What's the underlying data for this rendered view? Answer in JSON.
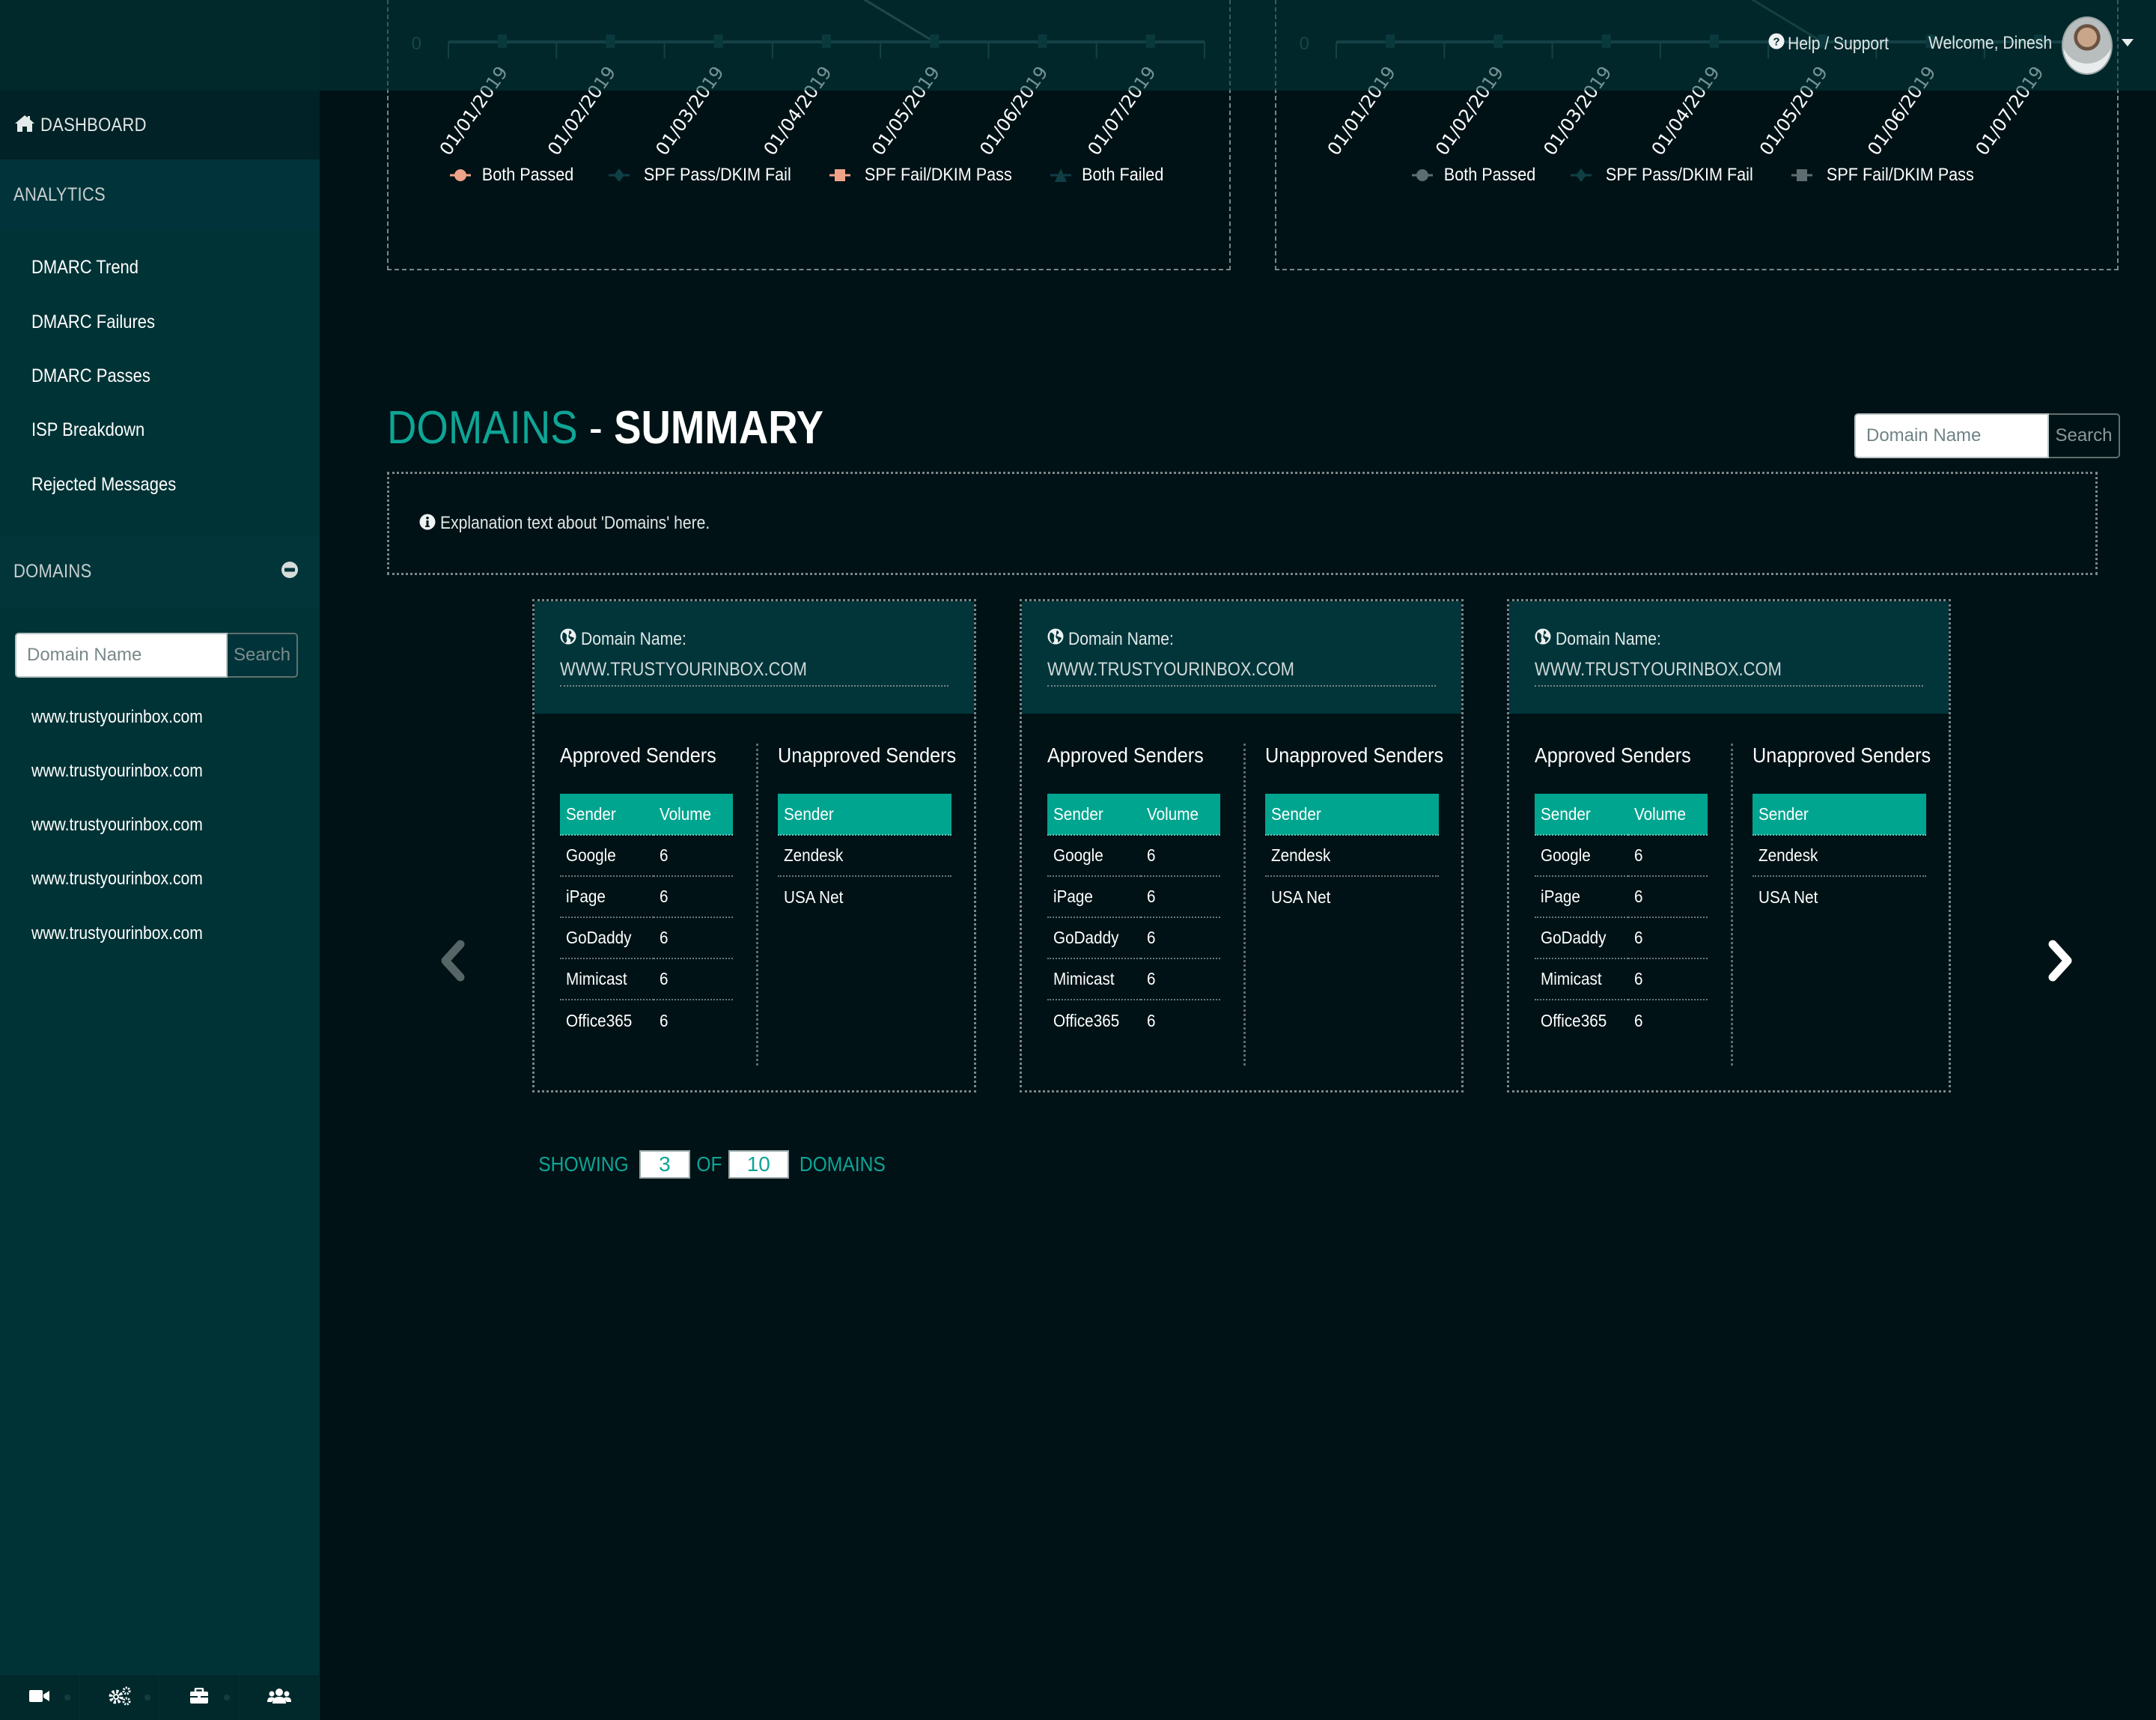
{
  "header": {
    "help_label": "Help / Support",
    "welcome_text": "Welcome, Dinesh",
    "avatar_icon": "user-avatar",
    "menu_icon": "caret-down-icon"
  },
  "sidebar": {
    "dashboard_label": "DASHBOARD",
    "dashboard_icon": "home-icon",
    "analytics_label": "ANALYTICS",
    "analytics_items": [
      {
        "label": "DMARC Trend"
      },
      {
        "label": "DMARC Failures"
      },
      {
        "label": "DMARC Passes"
      },
      {
        "label": "ISP Breakdown"
      },
      {
        "label": "Rejected Messages"
      }
    ],
    "domains_label": "DOMAINS",
    "domains_toggle_icon": "minus-circle-icon",
    "search": {
      "placeholder": "Domain Name",
      "button_label": "Search"
    },
    "domain_links": [
      {
        "label": "www.trustyourinbox.com"
      },
      {
        "label": "www.trustyourinbox.com"
      },
      {
        "label": "www.trustyourinbox.com"
      },
      {
        "label": "www.trustyourinbox.com"
      },
      {
        "label": "www.trustyourinbox.com"
      }
    ],
    "bottom_tools": [
      {
        "icon": "video-camera-icon"
      },
      {
        "icon": "cogs-icon"
      },
      {
        "icon": "briefcase-icon"
      },
      {
        "icon": "users-icon"
      }
    ]
  },
  "chart_data": [
    {
      "type": "line",
      "title": "",
      "x": [
        "01/01/2019",
        "01/02/2019",
        "01/03/2019",
        "01/04/2019",
        "01/05/2019",
        "01/06/2019",
        "01/07/2019"
      ],
      "y_tick_visible": [
        "0"
      ],
      "legend_position": "bottom",
      "series": [
        {
          "name": "Both Passed",
          "color": "#f0a389",
          "marker": "circle"
        },
        {
          "name": "SPF Pass/DKIM Fail",
          "color": "#0f3f45",
          "marker": "diamond"
        },
        {
          "name": "SPF Fail/DKIM Pass",
          "color": "#f0a389",
          "marker": "square"
        },
        {
          "name": "Both Failed",
          "color": "#0f3f45",
          "marker": "triangle"
        }
      ],
      "note": "plot area scrolled out of view; only baseline at 0 and a descending segment ending at 01/05/2019 visible"
    },
    {
      "type": "line",
      "title": "",
      "x": [
        "01/01/2019",
        "01/02/2019",
        "01/03/2019",
        "01/04/2019",
        "01/05/2019",
        "01/06/2019",
        "01/07/2019"
      ],
      "y_tick_visible": [
        "0"
      ],
      "legend_position": "bottom",
      "series": [
        {
          "name": "Both Passed",
          "color": "#5e6e70",
          "marker": "circle"
        },
        {
          "name": "SPF Pass/DKIM Fail",
          "color": "#0f3f45",
          "marker": "diamond"
        },
        {
          "name": "SPF Fail/DKIM Pass",
          "color": "#5e6e70",
          "marker": "square"
        }
      ],
      "note": "plot area scrolled out of view; only baseline at 0 visible"
    }
  ],
  "main": {
    "title_part1": "DOMAINS",
    "title_sep": " - ",
    "title_part2": "SUMMARY",
    "search": {
      "placeholder": "Domain Name",
      "button_label": "Search"
    },
    "info_text": "Explanation text about 'Domains' here.",
    "info_icon": "info-circle-icon",
    "cards": [
      {
        "label": "Domain Name:",
        "domain": "WWW.TRUSTYOURINBOX.COM",
        "approved_title": "Approved Senders",
        "approved_headers": [
          "Sender",
          "Volume"
        ],
        "approved_rows": [
          [
            "Google",
            "6"
          ],
          [
            "iPage",
            "6"
          ],
          [
            "GoDaddy",
            "6"
          ],
          [
            "Mimicast",
            "6"
          ],
          [
            "Office365",
            "6"
          ]
        ],
        "unapproved_title": "Unapproved Senders",
        "unapproved_headers": [
          "Sender"
        ],
        "unapproved_rows": [
          [
            "Zendesk"
          ],
          [
            "USA Net"
          ]
        ]
      },
      {
        "label": "Domain Name:",
        "domain": "WWW.TRUSTYOURINBOX.COM",
        "approved_title": "Approved Senders",
        "approved_headers": [
          "Sender",
          "Volume"
        ],
        "approved_rows": [
          [
            "Google",
            "6"
          ],
          [
            "iPage",
            "6"
          ],
          [
            "GoDaddy",
            "6"
          ],
          [
            "Mimicast",
            "6"
          ],
          [
            "Office365",
            "6"
          ]
        ],
        "unapproved_title": "Unapproved Senders",
        "unapproved_headers": [
          "Sender"
        ],
        "unapproved_rows": [
          [
            "Zendesk"
          ],
          [
            "USA Net"
          ]
        ]
      },
      {
        "label": "Domain Name:",
        "domain": "WWW.TRUSTYOURINBOX.COM",
        "approved_title": "Approved Senders",
        "approved_headers": [
          "Sender",
          "Volume"
        ],
        "approved_rows": [
          [
            "Google",
            "6"
          ],
          [
            "iPage",
            "6"
          ],
          [
            "GoDaddy",
            "6"
          ],
          [
            "Mimicast",
            "6"
          ],
          [
            "Office365",
            "6"
          ]
        ],
        "unapproved_title": "Unapproved Senders",
        "unapproved_headers": [
          "Sender"
        ],
        "unapproved_rows": [
          [
            "Zendesk"
          ],
          [
            "USA Net"
          ]
        ]
      }
    ],
    "prev_icon": "chevron-left-icon",
    "next_icon": "chevron-right-icon",
    "pagination": {
      "showing_label": "SHOWING",
      "shown_count": "3",
      "of_label": "OF",
      "total_count": "10",
      "suffix_label": "DOMAINS"
    }
  },
  "colors": {
    "accent": "#0ea596",
    "table_header": "#00a58f",
    "sidebar_bg": "#003336",
    "main_bg": "#001216",
    "legend_coral": "#f0a389"
  }
}
